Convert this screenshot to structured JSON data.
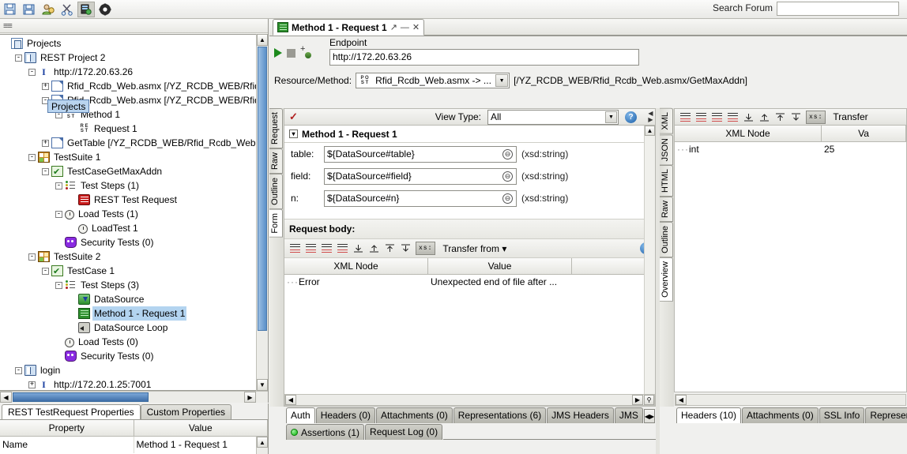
{
  "toolbar": {
    "icons": [
      "save-all-icon",
      "save-project-icon",
      "preferences-icon",
      "cut-icon",
      "endpoints-icon",
      "help-icon"
    ],
    "search_forum_label": "Search Forum",
    "search_forum_value": "",
    "search_forum_placeholder": ""
  },
  "navigator": {
    "tooltip": "Projects",
    "tree": [
      {
        "indent": 0,
        "toggle": "",
        "icon": "projects-root-icon",
        "label": "Projects",
        "selected": false
      },
      {
        "indent": 1,
        "toggle": "-",
        "icon": "project-icon",
        "label": "REST Project 2",
        "selected": false
      },
      {
        "indent": 2,
        "toggle": "-",
        "icon": "interface-icon",
        "label": "http://172.20.63.26",
        "selected": false
      },
      {
        "indent": 3,
        "toggle": "+",
        "icon": "resource-icon",
        "label": "Rfid_Rcdb_Web.asmx [/YZ_RCDB_WEB/Rfid",
        "selected": false
      },
      {
        "indent": 3,
        "toggle": "-",
        "icon": "resource-icon",
        "label": "Rfid_Rcdb_Web.asmx [/YZ_RCDB_WEB/Rfid",
        "selected": false
      },
      {
        "indent": 4,
        "toggle": "-",
        "icon": "method-post-icon",
        "label": "Method 1",
        "selected": false
      },
      {
        "indent": 5,
        "toggle": "",
        "icon": "rest-request-icon",
        "label": "Request 1",
        "selected": false
      },
      {
        "indent": 3,
        "toggle": "+",
        "icon": "resource-icon",
        "label": "GetTable [/YZ_RCDB_WEB/Rfid_Rcdb_Web.",
        "selected": false
      },
      {
        "indent": 2,
        "toggle": "-",
        "icon": "testsuite-icon",
        "label": "TestSuite 1",
        "selected": false
      },
      {
        "indent": 3,
        "toggle": "-",
        "icon": "testcase-icon",
        "label": "TestCaseGetMaxAddn",
        "selected": false
      },
      {
        "indent": 4,
        "toggle": "-",
        "icon": "teststeps-icon",
        "label": "Test Steps (1)",
        "selected": false
      },
      {
        "indent": 5,
        "toggle": "",
        "icon": "rest-test-request-icon",
        "label": "REST Test Request",
        "selected": false
      },
      {
        "indent": 4,
        "toggle": "-",
        "icon": "loadtests-icon",
        "label": "Load Tests (1)",
        "selected": false
      },
      {
        "indent": 5,
        "toggle": "",
        "icon": "loadtest-icon",
        "label": "LoadTest 1",
        "selected": false
      },
      {
        "indent": 4,
        "toggle": "",
        "icon": "security-tests-icon",
        "label": "Security Tests (0)",
        "selected": false
      },
      {
        "indent": 2,
        "toggle": "-",
        "icon": "testsuite-icon",
        "label": "TestSuite 2",
        "selected": false
      },
      {
        "indent": 3,
        "toggle": "-",
        "icon": "testcase-icon",
        "label": "TestCase 1",
        "selected": false
      },
      {
        "indent": 4,
        "toggle": "-",
        "icon": "teststeps-icon",
        "label": "Test Steps (3)",
        "selected": false
      },
      {
        "indent": 5,
        "toggle": "",
        "icon": "datasource-icon",
        "label": "DataSource",
        "selected": false
      },
      {
        "indent": 5,
        "toggle": "",
        "icon": "method-request-icon",
        "label": "Method 1 - Request 1",
        "selected": true
      },
      {
        "indent": 5,
        "toggle": "",
        "icon": "datasource-loop-icon",
        "label": "DataSource Loop",
        "selected": false
      },
      {
        "indent": 4,
        "toggle": "",
        "icon": "loadtests-icon",
        "label": "Load Tests (0)",
        "selected": false
      },
      {
        "indent": 4,
        "toggle": "",
        "icon": "security-tests-icon",
        "label": "Security Tests (0)",
        "selected": false
      },
      {
        "indent": 1,
        "toggle": "-",
        "icon": "project-icon",
        "label": "login",
        "selected": false
      },
      {
        "indent": 2,
        "toggle": "+",
        "icon": "interface-icon",
        "label": "http://172.20.1.25:7001",
        "selected": false
      }
    ]
  },
  "properties": {
    "tabs": [
      {
        "label": "REST TestRequest Properties",
        "active": true
      },
      {
        "label": "Custom Properties",
        "active": false
      }
    ],
    "columns": [
      "Property",
      "Value"
    ],
    "rows": [
      {
        "property": "Name",
        "value": "Method 1 - Request 1"
      }
    ]
  },
  "editor": {
    "tab": {
      "title": "Method 1 - Request 1",
      "icon": "rest-request-icon",
      "detach_label": "↗",
      "minimize_label": "—",
      "close_label": "✕"
    },
    "run_button": "run-icon",
    "stop_button": "stop-icon",
    "add_endpoint_button": "add-endpoint-icon",
    "endpoint_label": "Endpoint",
    "endpoint_value": "http://172.20.63.26",
    "resource_method_label": "Resource/Method:",
    "resource_method_value": "Rfid_Rcdb_Web.asmx -> ...",
    "resource_path": "[/YZ_RCDB_WEB/Rfid_Rcdb_Web.asmx/GetMaxAddn]"
  },
  "request_pane": {
    "vertical_tabs": [
      {
        "label": "Request",
        "active": false
      },
      {
        "label": "Raw",
        "active": false
      },
      {
        "label": "Outline",
        "active": false
      },
      {
        "label": "Form",
        "active": true
      }
    ],
    "view_type_label": "View Type:",
    "view_type_value": "All",
    "validation_icon": "validation-check-icon",
    "help_icon": "help-icon",
    "form": {
      "title": "Method 1 - Request 1",
      "fields": [
        {
          "label": "table:",
          "value": "${DataSource#table}",
          "type": "(xsd:string)"
        },
        {
          "label": "field:",
          "value": "${DataSource#field}",
          "type": "(xsd:string)"
        },
        {
          "label": "n:",
          "value": "${DataSource#n}",
          "type": "(xsd:string)"
        }
      ]
    },
    "request_body_label": "Request body:",
    "xml_toolbar": {
      "xs_button": "xs:",
      "transfer_label": "Transfer from",
      "help_icon": "help-icon"
    },
    "table": {
      "columns": [
        "XML Node",
        "Value",
        ""
      ],
      "rows": [
        {
          "node": "Error",
          "value": "Unexpected end of file after ..."
        }
      ]
    },
    "bottom_tabs_row1": [
      {
        "label": "Auth",
        "active": true
      },
      {
        "label": "Headers (0)",
        "active": false
      },
      {
        "label": "Attachments (0)",
        "active": false
      },
      {
        "label": "Representations (6)",
        "active": false
      },
      {
        "label": "JMS Headers",
        "active": false
      },
      {
        "label": "JMS",
        "active": false
      }
    ],
    "bottom_tabs_row2": [
      {
        "label": "Assertions (1)",
        "active": false,
        "status": "ok"
      },
      {
        "label": "Request Log (0)",
        "active": false
      }
    ]
  },
  "response_pane": {
    "vertical_tabs": [
      {
        "label": "XML",
        "active": false
      },
      {
        "label": "JSON",
        "active": false
      },
      {
        "label": "HTML",
        "active": false
      },
      {
        "label": "Raw",
        "active": false
      },
      {
        "label": "Outline",
        "active": false
      },
      {
        "label": "Overview",
        "active": true
      }
    ],
    "xml_toolbar": {
      "xs_button": "xs:",
      "transfer_label": "Transfer"
    },
    "table": {
      "columns": [
        "XML Node",
        "Va"
      ],
      "rows": [
        {
          "node": "int",
          "value": "25"
        }
      ]
    },
    "bottom_tabs": [
      {
        "label": "Headers (10)",
        "active": true
      },
      {
        "label": "Attachments (0)",
        "active": false
      },
      {
        "label": "SSL Info",
        "active": false
      },
      {
        "label": "Representa",
        "active": false
      }
    ]
  },
  "colors": {
    "selection": "#b3d4f0",
    "scrollbar_thumb": "#5a8fc8",
    "accent_red": "#b02020",
    "accent_green": "#2d8f2d"
  }
}
